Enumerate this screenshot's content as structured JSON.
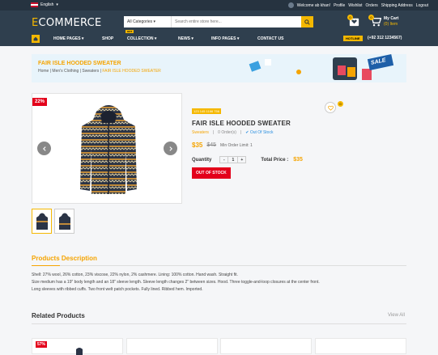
{
  "topbar": {
    "language": "English",
    "welcome": "Welcome ab khan!",
    "links": [
      "Profile",
      "Wishlist",
      "Orders",
      "Shipping Address",
      "Logout"
    ]
  },
  "header": {
    "logo_first": "E",
    "logo_rest": "COMMERCE",
    "search_category": "All Categories",
    "search_placeholder": "Search entire store here...",
    "wishlist_count": "0",
    "cart_count": "0",
    "cart_title": "My Cart",
    "cart_sub": "(0) Item"
  },
  "nav": {
    "items": [
      "HOME PAGES",
      "SHOP",
      "COLLECTION",
      "NEWS",
      "INFO PAGES",
      "CONTACT US"
    ],
    "hot_badge": "HOT",
    "hotline_label": "HOTLINE",
    "phone": "(+92 312 1234567)"
  },
  "banner": {
    "title": "FAIR ISLE HOODED SWEATER",
    "crumbs": [
      "Home",
      "Men's Clothing",
      "Sweaters"
    ],
    "current": "FAIR ISLE HOODED SWEATER",
    "sale_text": "SALE"
  },
  "product": {
    "discount": "22%",
    "code": "123 145 1166 756",
    "name": "FAIR ISLE HOODED SWEATER",
    "brand": "Sweaters",
    "orders": "0 Order(s)",
    "stock": "Out Of Stock",
    "price": "$35",
    "old_price": "$45",
    "min_order": "Min Order Limit: 1",
    "quantity_label": "Quantity",
    "quantity_minus": "-",
    "quantity_value": "1",
    "quantity_plus": "+",
    "total_label": "Total Price :",
    "total_price": "$35",
    "out_of_stock_btn": "OUT OF STOCK",
    "wish_count": "0"
  },
  "description": {
    "title": "Products Description",
    "lines": [
      "Shell: 27% wool, 26% cotton, 23% viscose, 22% nylon, 2% cashmere. Lining: 100% cotton. Hand wash. Straight fit.",
      "Size medium has a 19\" body length and an 18\" sleeve length. Sleeve length changes 2\" between sizes. Hood. Three toggle-and-loop closures at the center front.",
      "Long sleeves with ribbed cuffs. Two front welt patch pockets. Fully lined. Ribbed hem. Imported."
    ]
  },
  "related": {
    "title": "Related Products",
    "view_all": "View All",
    "first_discount": "57%"
  },
  "colors": {
    "accent": "#f5b800",
    "header": "#2f3f4e",
    "topbar": "#263340",
    "sale": "#e3001b"
  }
}
